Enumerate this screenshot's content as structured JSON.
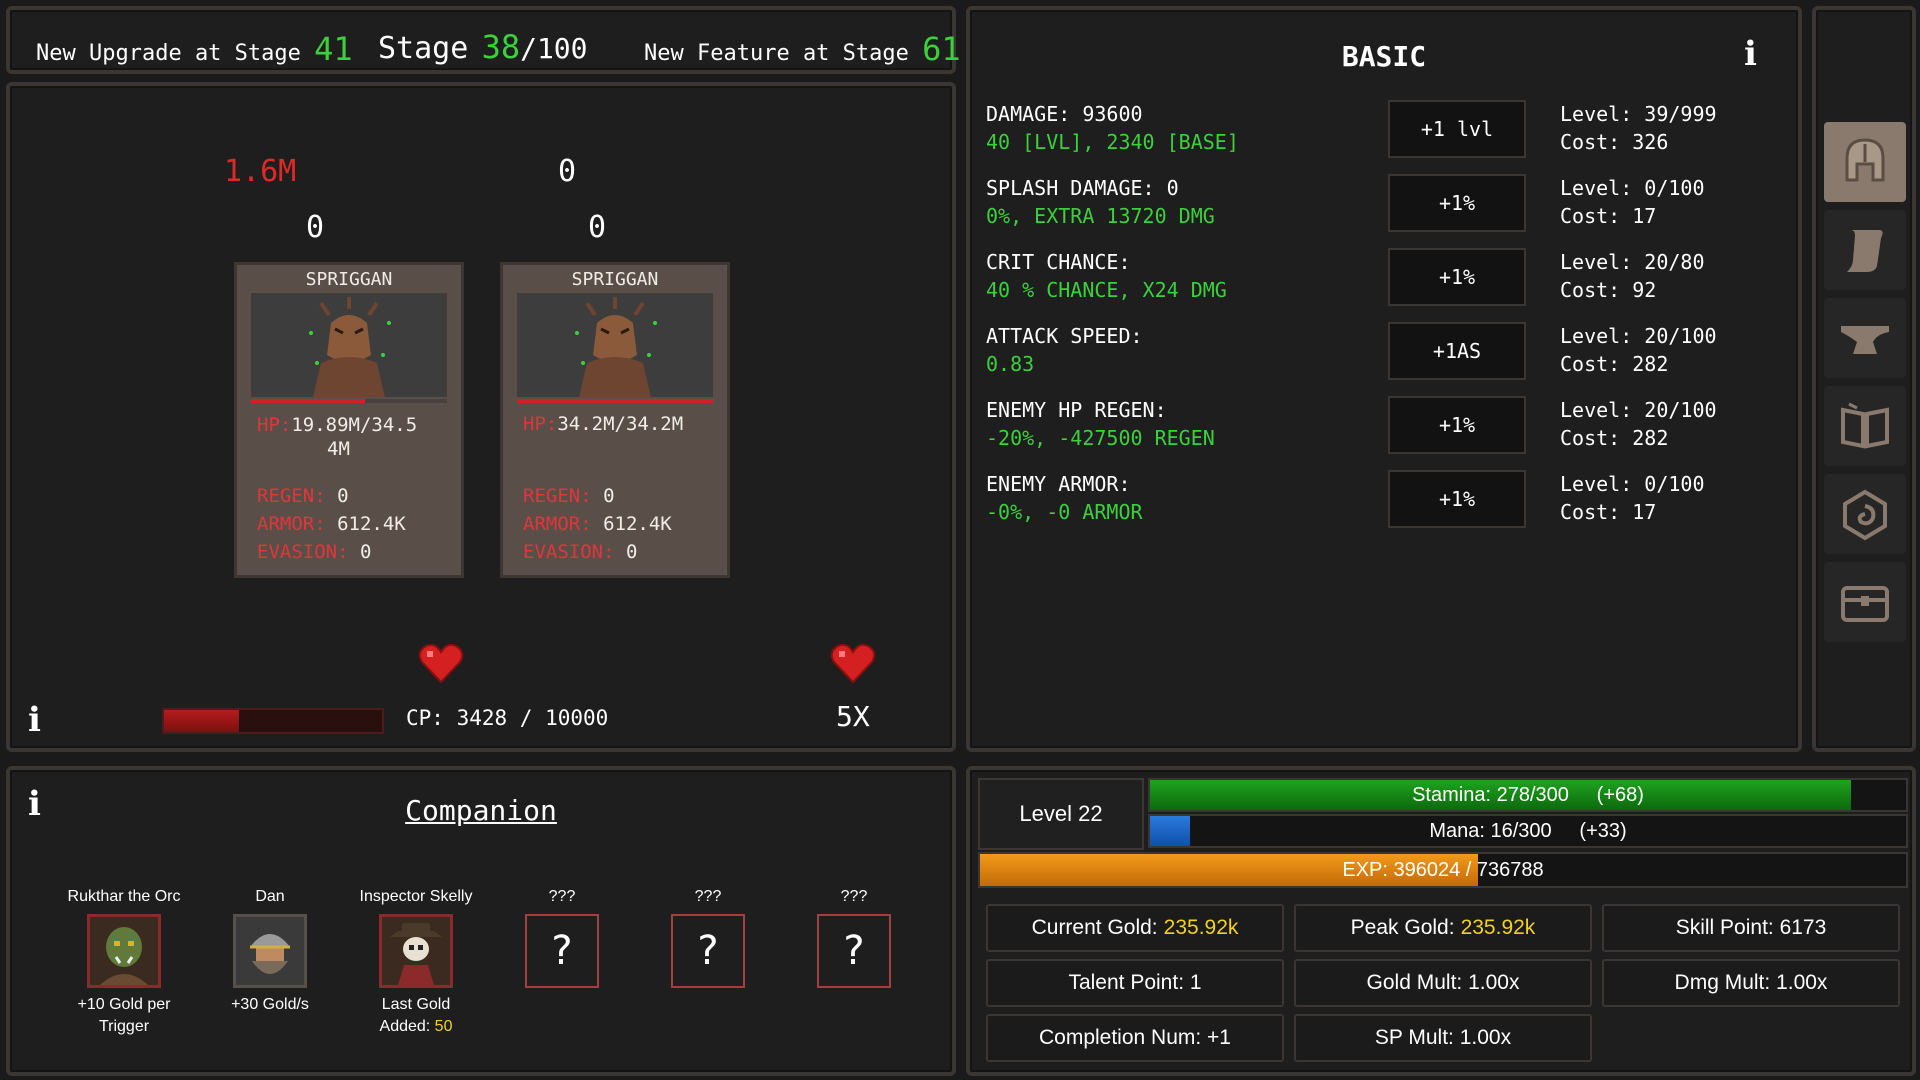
{
  "topbar": {
    "upgrade_prefix": "New Upgrade at Stage",
    "upgrade_stage": "41",
    "stage_label": "Stage",
    "stage_current": "38",
    "stage_total": "/100",
    "feature_prefix": "New Feature at Stage",
    "feature_stage": "61"
  },
  "battle": {
    "damage_left": "1.6M",
    "damage_right": "0",
    "sub_left": "0",
    "sub_right": "0",
    "enemies": [
      {
        "name": "SPRIGGAN",
        "hp_label": "HP:",
        "hp_line1": "19.89M/34.5",
        "hp_line2": "4M",
        "hp_fraction": 0.58,
        "regen_label": "REGEN:",
        "regen": "0",
        "armor_label": "ARMOR:",
        "armor": "612.4K",
        "evasion_label": "EVASION:",
        "evasion": "0"
      },
      {
        "name": "SPRIGGAN",
        "hp_label": "HP:",
        "hp_line1": "34.2M/34.2M",
        "hp_line2": "",
        "hp_fraction": 1.0,
        "regen_label": "REGEN:",
        "regen": "0",
        "armor_label": "ARMOR:",
        "armor": "612.4K",
        "evasion_label": "EVASION:",
        "evasion": "0"
      }
    ],
    "cp_text": "CP: 3428 / 10000",
    "cp_fraction": 0.3428,
    "multiplier": "5X",
    "info": "i"
  },
  "upgrades": {
    "title": "BASIC",
    "info": "i",
    "items": [
      {
        "name": "DAMAGE: 93600",
        "sub": "40 [LVL], 2340 [BASE]",
        "button": "+1 lvl",
        "level": "Level: 39/999",
        "cost": "Cost: 326"
      },
      {
        "name": "SPLASH DAMAGE: 0",
        "sub": "0%, EXTRA 13720 DMG",
        "button": "+1%",
        "level": "Level: 0/100",
        "cost": "Cost: 17"
      },
      {
        "name": "CRIT CHANCE:",
        "sub": "40 % CHANCE, X24 DMG",
        "button": "+1%",
        "level": "Level: 20/80",
        "cost": "Cost: 92"
      },
      {
        "name": "ATTACK SPEED:",
        "sub": "0.83",
        "button": "+1AS",
        "level": "Level: 20/100",
        "cost": "Cost: 282"
      },
      {
        "name": "ENEMY HP REGEN:",
        "sub": "-20%, -427500 REGEN",
        "button": "+1%",
        "level": "Level: 20/100",
        "cost": "Cost: 282"
      },
      {
        "name": "ENEMY ARMOR:",
        "sub": "-0%, -0 ARMOR",
        "button": "+1%",
        "level": "Level: 0/100",
        "cost": "Cost: 17"
      }
    ]
  },
  "sidebar": {
    "icons": [
      "helmet-icon",
      "scroll-icon",
      "anvil-icon",
      "book-icon",
      "spiral-icon",
      "chest-icon"
    ]
  },
  "companions": {
    "info": "i",
    "title": "Companion",
    "items": [
      {
        "name": "Rukthar the Orc",
        "desc1": "+10 Gold per",
        "desc2": "Trigger",
        "highlight": ""
      },
      {
        "name": "Dan",
        "desc1": "+30 Gold/s",
        "desc2": "",
        "highlight": ""
      },
      {
        "name": "Inspector Skelly",
        "desc1": "Last Gold",
        "desc2": "Added: ",
        "highlight": "50"
      },
      {
        "name": "???",
        "desc1": "",
        "desc2": "",
        "highlight": "",
        "mark": "?"
      },
      {
        "name": "???",
        "desc1": "",
        "desc2": "",
        "highlight": "",
        "mark": "?"
      },
      {
        "name": "???",
        "desc1": "",
        "desc2": "",
        "highlight": "",
        "mark": "?"
      }
    ]
  },
  "stats": {
    "level": "Level 22",
    "stamina_text": "Stamina: 278/300     (+68)",
    "stamina_fraction": 0.927,
    "mana_text": "Mana: 16/300     (+33)",
    "mana_fraction": 0.053,
    "exp_text": "EXP: 396024 / 736788",
    "exp_fraction": 0.5375,
    "current_gold_label": "Current Gold: ",
    "current_gold": "235.92k",
    "peak_gold_label": "Peak Gold: ",
    "peak_gold": "235.92k",
    "skill_point": "Skill Point: 6173",
    "talent_point": "Talent Point: 1",
    "gold_mult": "Gold Mult: 1.00x",
    "dmg_mult": "Dmg Mult: 1.00x",
    "completion": "Completion Num: +1",
    "sp_mult": "SP Mult: 1.00x"
  },
  "colors": {
    "accent_green": "#3bd13b",
    "damage_red": "#e02828",
    "gold_yellow": "#f2d21b",
    "stamina": "#1f9a1f",
    "mana": "#1d64c4",
    "exp": "#e8880c"
  }
}
